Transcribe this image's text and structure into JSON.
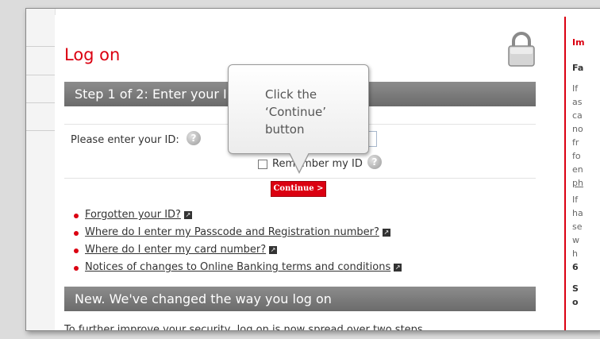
{
  "page": {
    "title": "Log on",
    "step_heading": "Step 1 of 2: Enter your ID",
    "id_label": "Please enter your ID:",
    "remember_label": "Remember my ID",
    "continue_label": "Continue >",
    "links": [
      {
        "label": "Forgotten your ID?"
      },
      {
        "label": "Where do I enter my Passcode and Registration number?"
      },
      {
        "label": "Where do I enter my card number?"
      },
      {
        "label": "Notices of changes to Online Banking terms and conditions"
      }
    ],
    "new_heading": "New. We've changed the way you log on",
    "intro_text": "To further improve your security, log on is now spread over two steps."
  },
  "tooltip": {
    "text": "Click the ‘Continue’ button"
  },
  "sidebar": {
    "lines": [
      "Im",
      "",
      "Fa",
      "",
      "If",
      "as",
      "ca",
      "no",
      "fr",
      "fo",
      "en",
      "ph",
      "If",
      "ha",
      "se",
      "w",
      "h",
      "6",
      "",
      "S",
      "o"
    ]
  },
  "icons": {
    "help": "question-mark-icon",
    "lock": "padlock-icon",
    "external": "external-link-icon"
  },
  "colors": {
    "accent": "#db0011",
    "bar": "#7a7a7a"
  }
}
